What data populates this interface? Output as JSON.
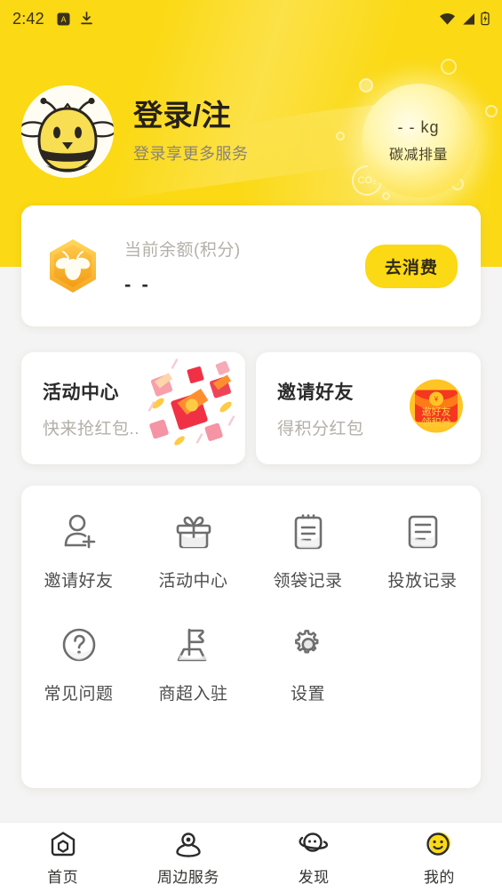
{
  "statusbar": {
    "time": "2:42",
    "icons": [
      "app-badge-icon",
      "download-icon",
      "wifi-icon",
      "cellular-signal-icon",
      "battery-icon"
    ]
  },
  "header": {
    "avatar": "bee-avatar",
    "title": "登录/注",
    "subtitle": "登录享更多服务",
    "carbon": {
      "value": "- - kg",
      "label": "碳减排量",
      "bubble_text": "CO₂"
    },
    "background_color": "#FBD914"
  },
  "balance": {
    "icon": "honeycomb-bee-icon",
    "label": "当前余额(积分)",
    "value": "- -",
    "button_label": "去消费",
    "button_color": "#FBD914"
  },
  "promos": [
    {
      "title": "活动中心",
      "subtitle": "快来抢红包..",
      "art": "red-envelopes-illustration"
    },
    {
      "title": "邀请好友",
      "subtitle": "得积分红包",
      "art": "invite-envelope-badge",
      "art_text_line1": "邀好友",
      "art_text_line2": "领积分"
    }
  ],
  "menu": {
    "rows": [
      [
        {
          "label": "邀请好友",
          "icon": "user-add-icon"
        },
        {
          "label": "活动中心",
          "icon": "gift-icon"
        },
        {
          "label": "领袋记录",
          "icon": "clipboard-icon"
        },
        {
          "label": "投放记录",
          "icon": "document-icon"
        }
      ],
      [
        {
          "label": "常见问题",
          "icon": "question-circle-icon"
        },
        {
          "label": "商超入驻",
          "icon": "flag-store-icon"
        },
        {
          "label": "设置",
          "icon": "gear-icon"
        }
      ]
    ]
  },
  "navbar": {
    "items": [
      {
        "label": "首页",
        "icon": "home-icon",
        "active": false
      },
      {
        "label": "周边服务",
        "icon": "location-pin-icon",
        "active": false
      },
      {
        "label": "发现",
        "icon": "discover-planet-icon",
        "active": false
      },
      {
        "label": "我的",
        "icon": "smiley-profile-icon",
        "active": true
      }
    ],
    "active_color": "#FBD914"
  }
}
